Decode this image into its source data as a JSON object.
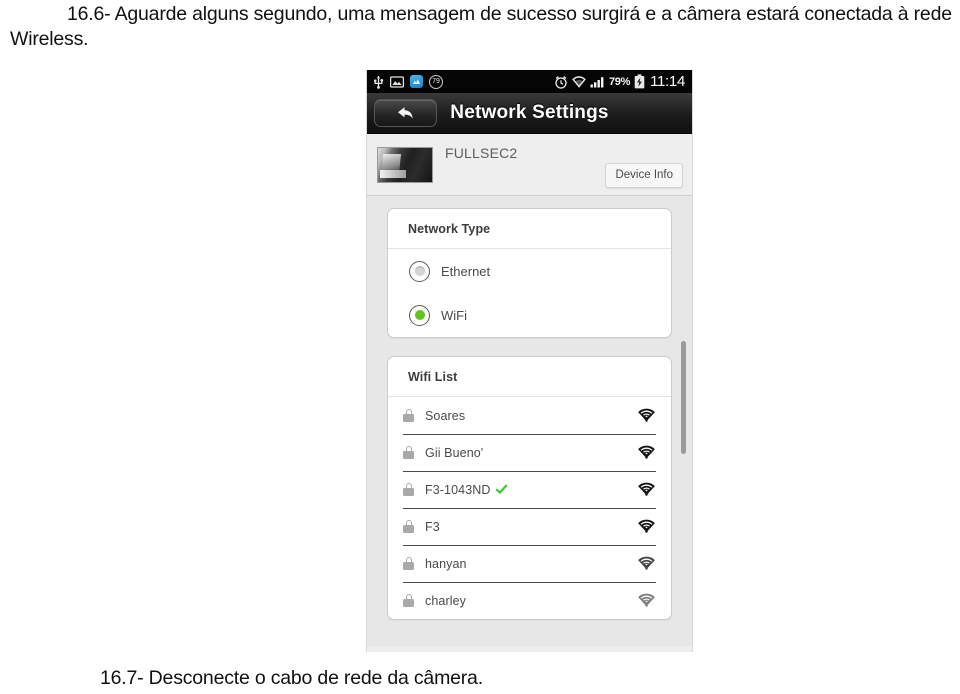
{
  "document": {
    "paragraph_top": "16.6- Aguarde alguns segundo, uma mensagem de sucesso surgirá e a câmera estará conectada à rede Wireless.",
    "paragraph_bottom": "16.7- Desconecte o cabo de rede da câmera."
  },
  "screenshot": {
    "status_bar": {
      "usb_icon": "usb-icon",
      "gallery_icon": "image-icon",
      "app_icon": "app-icon",
      "badge_count": "79",
      "alarm_icon": "alarm-clock-icon",
      "wifi_icon": "wifi-icon",
      "signal_icon": "cell-signal-icon",
      "battery_percent": "79%",
      "battery_icon": "battery-charging-icon",
      "clock": "11:14"
    },
    "title_bar": {
      "back_icon": "back-arrow-icon",
      "title": "Network Settings"
    },
    "device": {
      "thumbnail": "camera-snapshot-thumbnail",
      "name": "FULLSEC2",
      "info_button": "Device Info"
    },
    "network_type": {
      "header": "Network Type",
      "options": [
        {
          "label": "Ethernet",
          "selected": false
        },
        {
          "label": "WiFi",
          "selected": true
        }
      ],
      "selected_color": "#62c31c"
    },
    "wifi_list": {
      "header": "Wifi List",
      "items": [
        {
          "ssid": "Soares",
          "locked": true,
          "connected": false,
          "strength": 4
        },
        {
          "ssid": "Gii Bueno'",
          "locked": true,
          "connected": false,
          "strength": 4
        },
        {
          "ssid": "F3-1043ND",
          "locked": true,
          "connected": true,
          "strength": 4
        },
        {
          "ssid": "F3",
          "locked": true,
          "connected": false,
          "strength": 4
        },
        {
          "ssid": "hanyan",
          "locked": true,
          "connected": false,
          "strength": 3
        },
        {
          "ssid": "charley",
          "locked": true,
          "connected": false,
          "strength": 2
        }
      ],
      "connected_check_color": "#35cc28"
    }
  }
}
